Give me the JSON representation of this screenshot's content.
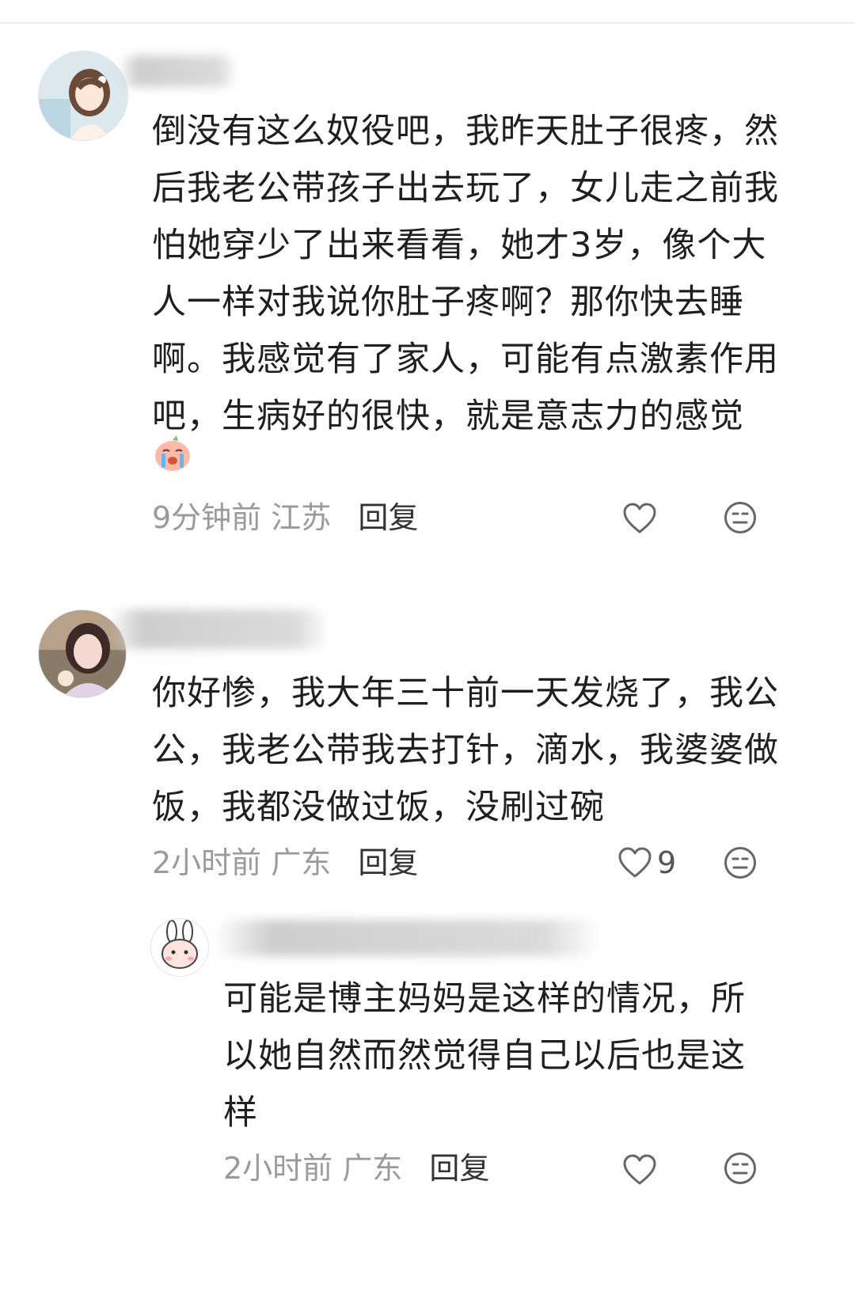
{
  "comments": [
    {
      "text": "倒没有这么奴役吧，我昨天肚子很疼，然后我老公带孩子出去玩了，女儿走之前我怕她穿少了出来看看，她才3岁，像个大人一样对我说你肚子疼啊？那你快去睡啊。我感觉有了家人，可能有点激素作用吧，生病好的很快，就是意志力的感觉",
      "time": "9分钟前",
      "location": "江苏",
      "reply_label": "回复",
      "likes": ""
    },
    {
      "text": "你好惨，我大年三十前一天发烧了，我公公，我老公带我去打针，滴水，我婆婆做饭，我都没做过饭，没刷过碗",
      "time": "2小时前",
      "location": "广东",
      "reply_label": "回复",
      "likes": "9"
    },
    {
      "text": "可能是博主妈妈是这样的情况，所以她自然而然觉得自己以后也是这样",
      "time": "2小时前",
      "location": "广东",
      "reply_label": "回复",
      "likes": ""
    }
  ],
  "icons": {
    "like": "heart-outline-icon",
    "dislike": "meh-face-icon",
    "sticker": "crying-peach-sticker"
  },
  "colors": {
    "meta": "#9a9a9a",
    "reply": "#333333",
    "text": "#1f1f1f"
  }
}
